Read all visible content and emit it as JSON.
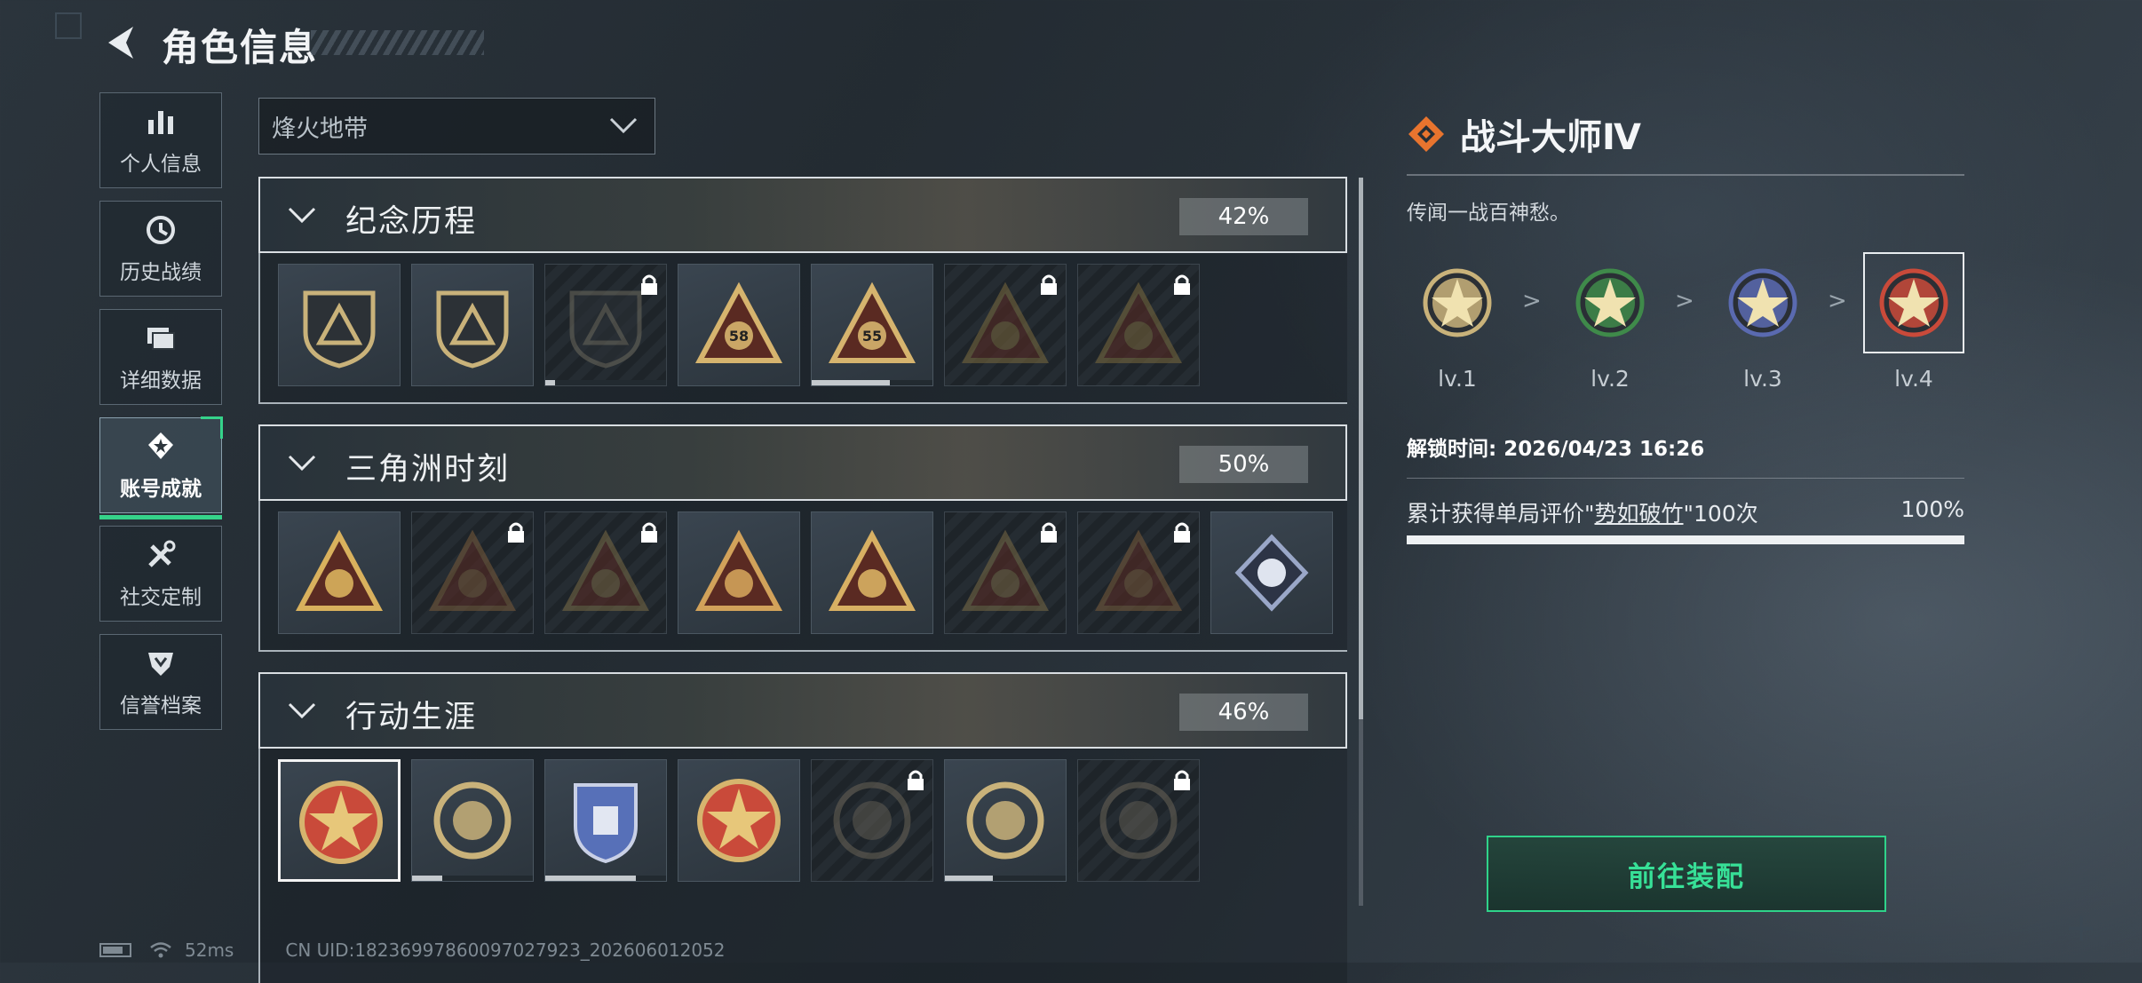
{
  "header": {
    "title": "角色信息"
  },
  "nav": [
    {
      "id": "profile",
      "label": "个人信息"
    },
    {
      "id": "history",
      "label": "历史战绩"
    },
    {
      "id": "data",
      "label": "详细数据"
    },
    {
      "id": "achievements",
      "label": "账号成就",
      "active": true
    },
    {
      "id": "social",
      "label": "社交定制"
    },
    {
      "id": "credit",
      "label": "信誉档案"
    }
  ],
  "mode_select": {
    "value": "烽火地带"
  },
  "categories": [
    {
      "title": "纪念历程",
      "percent": "42%",
      "badges": [
        {
          "locked": false,
          "progress": null,
          "color": "#c9b27a"
        },
        {
          "locked": false,
          "progress": null,
          "color": "#c9b27a"
        },
        {
          "locked": true,
          "progress": 0.08,
          "color": "#6d6a5e"
        },
        {
          "locked": false,
          "progress": null,
          "color": "#d6b46e",
          "number": "58"
        },
        {
          "locked": false,
          "progress": 0.65,
          "color": "#d6b46e",
          "number": "55"
        },
        {
          "locked": true,
          "progress": null,
          "color": "#7b6a3e"
        },
        {
          "locked": true,
          "progress": null,
          "color": "#7b6a3e"
        }
      ]
    },
    {
      "title": "三角洲时刻",
      "percent": "50%",
      "badges": [
        {
          "locked": false,
          "progress": null,
          "color": "#d9b15d"
        },
        {
          "locked": true,
          "progress": null,
          "color": "#7a5b3b"
        },
        {
          "locked": true,
          "progress": null,
          "color": "#7a6a45"
        },
        {
          "locked": false,
          "progress": null,
          "color": "#d2a25a"
        },
        {
          "locked": false,
          "progress": null,
          "color": "#d8b063"
        },
        {
          "locked": true,
          "progress": null,
          "color": "#7a6a45"
        },
        {
          "locked": true,
          "progress": null,
          "color": "#7a5b3b"
        },
        {
          "locked": false,
          "progress": null,
          "color": "#9aa7c8",
          "special": true
        }
      ]
    },
    {
      "title": "行动生涯",
      "percent": "46%",
      "badges": [
        {
          "locked": false,
          "progress": null,
          "color": "#c94a3a",
          "selected": true
        },
        {
          "locked": false,
          "progress": 0.25,
          "color": "#c9b27a"
        },
        {
          "locked": false,
          "progress": 0.75,
          "color": "#5770b8"
        },
        {
          "locked": false,
          "progress": null,
          "color": "#c94a3a"
        },
        {
          "locked": true,
          "progress": null,
          "color": "#6a6458"
        },
        {
          "locked": false,
          "progress": 0.4,
          "color": "#c9b27a"
        },
        {
          "locked": true,
          "progress": null,
          "color": "#6a6458"
        }
      ]
    }
  ],
  "detail": {
    "title": "战斗大师Ⅳ",
    "description": "传闻一战百神愁。",
    "levels": [
      {
        "label": "lv.1",
        "color": "#c9b27a"
      },
      {
        "label": "lv.2",
        "color": "#3f8a4a"
      },
      {
        "label": "lv.3",
        "color": "#5a6ab0"
      },
      {
        "label": "lv.4",
        "color": "#c94a3a",
        "selected": true
      }
    ],
    "level_separator": ">",
    "unlock_time": "解锁时间: 2026/04/23 16:26",
    "requirement": {
      "prefix": "累计获得单局评价\"",
      "highlight": "势如破竹",
      "suffix": "\"100次",
      "percent": "100%",
      "progress": 1.0
    }
  },
  "actions": {
    "equip_label": "前往装配"
  },
  "footer": {
    "ping": "52ms",
    "uid": "CN UID:18236997860097027923_202606012052"
  },
  "colors": {
    "accent_green": "#35d38a"
  },
  "icons": {
    "back": "back-arrow-icon",
    "lock": "lock-icon",
    "chevron": "chevron-down-icon",
    "title_badge": "diamond-icon"
  }
}
